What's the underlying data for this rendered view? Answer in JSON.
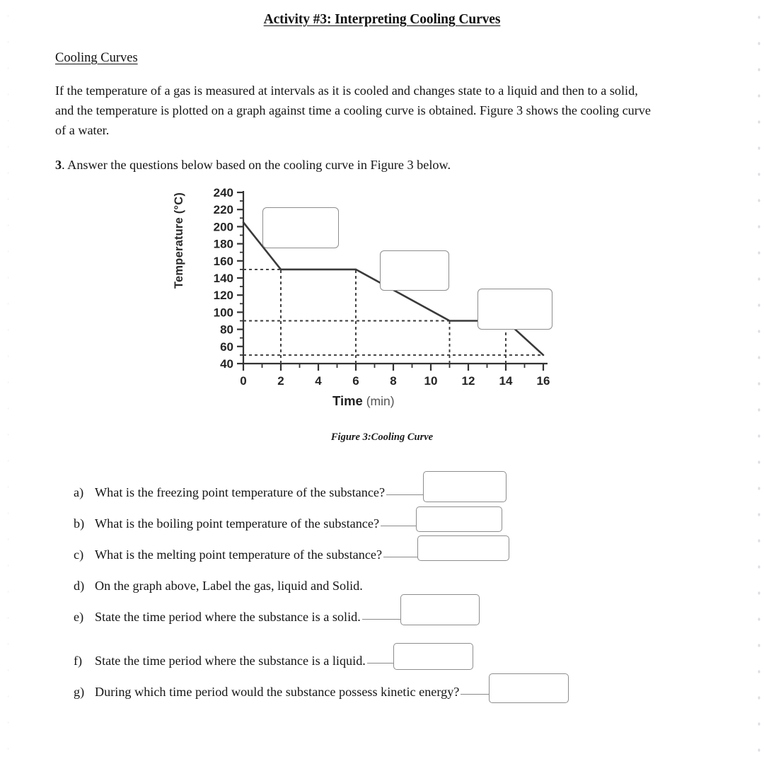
{
  "document": {
    "title": "Activity #3: Interpreting Cooling Curves",
    "section_heading": "Cooling Curves",
    "intro_paragraph": "If the temperature of a gas is measured at intervals as it is cooled and changes state to a liquid and then to a solid, and the temperature is plotted on a graph against time a cooling curve is obtained. Figure 3 shows the cooling curve of a water.",
    "question_number": "3",
    "question_lead": ". Answer the questions below based on the cooling curve in Figure 3 below.",
    "figure_caption": "Figure 3:Cooling Curve"
  },
  "chart_data": {
    "type": "line",
    "title": "",
    "xlabel_bold": "Time",
    "xlabel_light": "(min)",
    "ylabel": "Temperature (°C)",
    "xlim": [
      0,
      16
    ],
    "ylim": [
      40,
      240
    ],
    "xticks": [
      0,
      2,
      4,
      6,
      8,
      10,
      12,
      14,
      16
    ],
    "xtick_labels": [
      "0",
      "2",
      "4",
      "6",
      "8",
      "10",
      "12",
      "14",
      "16"
    ],
    "xminorticks": [
      1,
      3,
      5,
      7,
      9,
      11,
      13,
      15
    ],
    "yticks": [
      40,
      60,
      80,
      100,
      120,
      140,
      160,
      180,
      200,
      220,
      240
    ],
    "ytick_labels": [
      "40",
      "60",
      "80",
      "100",
      "120",
      "140",
      "160",
      "180",
      "200",
      "220",
      "240"
    ],
    "grid": false,
    "series": [
      {
        "name": "Cooling curve of water",
        "x": [
          0,
          2,
          6,
          11,
          14,
          16
        ],
        "y": [
          205,
          150,
          150,
          90,
          90,
          50
        ]
      }
    ],
    "reference_lines": {
      "horizontal": [
        150,
        90,
        50
      ],
      "vertical": [
        2,
        6,
        11,
        14
      ]
    },
    "annotations": [
      {
        "name": "callout-box-1",
        "text": "",
        "x": 1.0,
        "y": 222,
        "w_units": 4.1,
        "h_units": 48
      },
      {
        "name": "callout-box-2",
        "text": "",
        "x": 7.3,
        "y": 172,
        "w_units": 3.7,
        "h_units": 47
      },
      {
        "name": "callout-box-3",
        "text": "",
        "x": 12.5,
        "y": 127,
        "w_units": 4.0,
        "h_units": 48
      }
    ]
  },
  "questions": [
    {
      "marker": "a)",
      "text": "What is the freezing point temperature of the substance?",
      "answer": ""
    },
    {
      "marker": "b)",
      "text": "What is the boiling point temperature of the substance?",
      "answer": ""
    },
    {
      "marker": "c)",
      "text": "What is the melting point temperature of the substance?",
      "answer": ""
    },
    {
      "marker": "d)",
      "text": "On the graph above, Label the gas, liquid and Solid.",
      "answer": ""
    },
    {
      "marker": "e)",
      "text": "State the time period where the substance is a solid.",
      "answer": ""
    },
    {
      "marker": "f)",
      "text": "State the time period where the substance is a liquid.",
      "answer": ""
    },
    {
      "marker": "g)",
      "text": "During which time period would the substance possess kinetic energy?",
      "answer": ""
    }
  ],
  "colors": {
    "page_background": "#ffffff",
    "text": "#151515",
    "curve": "#3a3a3a",
    "axis": "#333333",
    "box_border": "#8d8d8d",
    "dot_grid": "#dcdee3"
  }
}
